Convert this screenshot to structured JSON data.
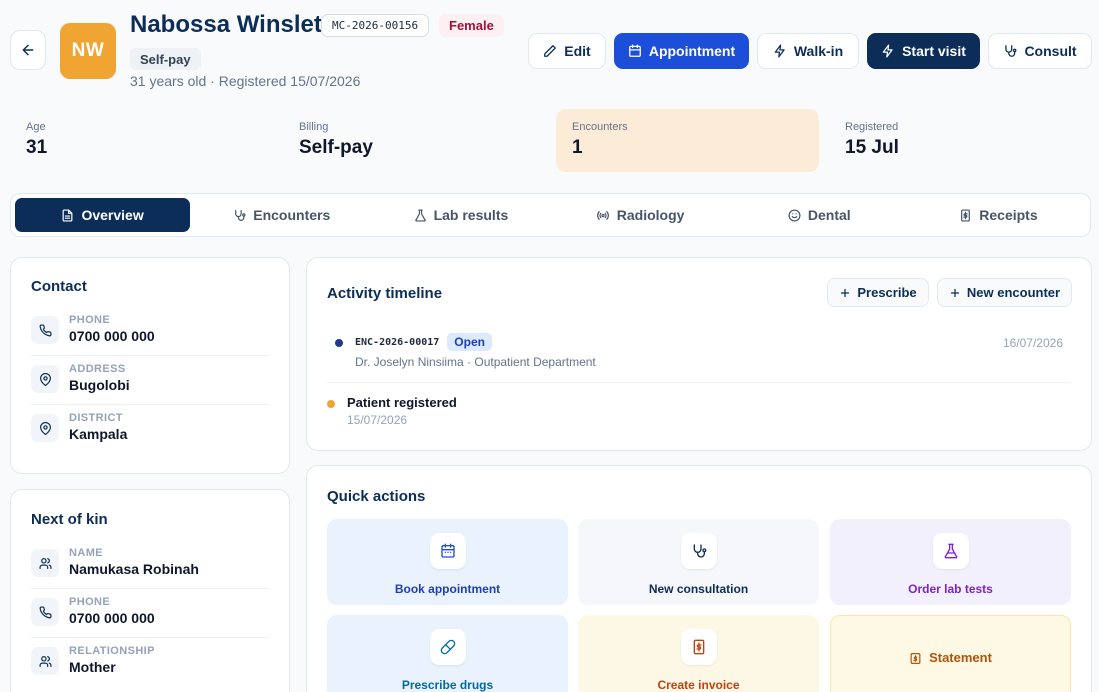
{
  "patient": {
    "initials": "NW",
    "name": "Nabossa Winslet",
    "mrn": "MC-2026-00156",
    "gender": "Female",
    "billing": "Self-pay",
    "subline": "31 years old · Registered 15/07/2026"
  },
  "header_actions": {
    "edit": "Edit",
    "appointment": "Appointment",
    "walk_in": "Walk-in",
    "start_visit": "Start visit",
    "consult": "Consult"
  },
  "stats": [
    {
      "label": "Age",
      "value": "31"
    },
    {
      "label": "Billing",
      "value": "Self-pay"
    },
    {
      "label": "Encounters",
      "value": "1"
    },
    {
      "label": "Registered",
      "value": "15 Jul"
    }
  ],
  "tabs": [
    {
      "label": "Overview",
      "icon": "document-icon"
    },
    {
      "label": "Encounters",
      "icon": "stethoscope-icon"
    },
    {
      "label": "Lab results",
      "icon": "flask-icon"
    },
    {
      "label": "Radiology",
      "icon": "radio-icon"
    },
    {
      "label": "Dental",
      "icon": "smile-icon"
    },
    {
      "label": "Receipts",
      "icon": "receipt-icon"
    }
  ],
  "contact": {
    "title": "Contact",
    "rows": [
      {
        "label": "PHONE",
        "value": "0700 000 000",
        "icon": "phone-icon"
      },
      {
        "label": "ADDRESS",
        "value": "Bugolobi",
        "icon": "map-pin-icon"
      },
      {
        "label": "DISTRICT",
        "value": "Kampala",
        "icon": "map-pin-icon"
      }
    ]
  },
  "next_of_kin": {
    "title": "Next of kin",
    "rows": [
      {
        "label": "NAME",
        "value": "Namukasa Robinah",
        "icon": "users-icon"
      },
      {
        "label": "PHONE",
        "value": "0700 000 000",
        "icon": "phone-icon"
      },
      {
        "label": "RELATIONSHIP",
        "value": "Mother",
        "icon": "users-icon"
      }
    ]
  },
  "timeline": {
    "title": "Activity timeline",
    "prescribe": "Prescribe",
    "new_encounter": "New encounter",
    "items": [
      {
        "code": "ENC-2026-00017",
        "status": "Open",
        "detail": "Dr. Joselyn Ninsiima · Outpatient Department",
        "date": "16/07/2026"
      },
      {
        "title": "Patient registered",
        "date": "15/07/2026"
      }
    ]
  },
  "quick_actions": {
    "title": "Quick actions",
    "items": [
      {
        "label": "Book appointment",
        "icon": "calendar-icon",
        "bg": "#eaf3fd",
        "color": "#1d4ed8"
      },
      {
        "label": "New consultation",
        "icon": "stethoscope-icon",
        "bg": "#f5f7fa",
        "color": "#0c2d57"
      },
      {
        "label": "Order lab tests",
        "icon": "flask-icon",
        "bg": "#f3f0fd",
        "color": "#7e22ce"
      },
      {
        "label": "Prescribe drugs",
        "icon": "pill-icon",
        "bg": "#eaf3fd",
        "color": "#0369a1"
      },
      {
        "label": "Create invoice",
        "icon": "invoice-icon",
        "bg": "#fdf8e6",
        "color": "#c2410c"
      },
      {
        "label": "Statement",
        "icon": "statement-icon",
        "bg": "#fdf9e4",
        "color": "#b45309"
      }
    ]
  },
  "colors": {
    "navy": "#0c2d57",
    "primary": "#1d4ed8",
    "avatar": "#f0a532",
    "highlight": "#fcebd6"
  }
}
